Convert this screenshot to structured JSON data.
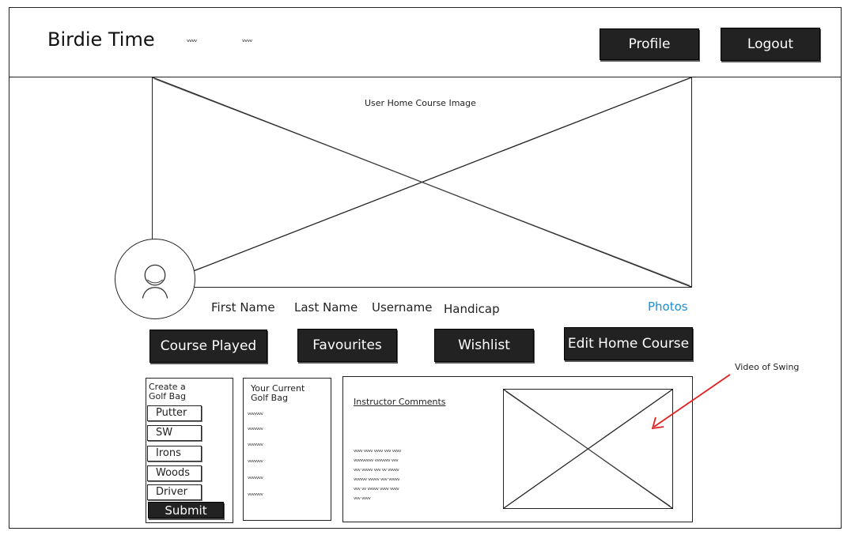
{
  "header": {
    "brand": "Birdie Time",
    "nav_squiggles": [
      "ᵥᵥᵥᵥ",
      "ᵥᵥᵥᵥ"
    ],
    "profile_label": "Profile",
    "logout_label": "Logout"
  },
  "hero": {
    "caption": "User Home Course Image"
  },
  "profile": {
    "first_name": "First Name",
    "last_name": "Last Name",
    "username": "Username",
    "handicap": "Handicap",
    "photos_link": "Photos"
  },
  "tabs": [
    {
      "label": "Course Played"
    },
    {
      "label": "Favourites"
    },
    {
      "label": "Wishlist"
    },
    {
      "label": "Edit Home Course"
    }
  ],
  "golf_bag_builder": {
    "title_line1": "Create a",
    "title_line2": "Golf Bag",
    "clubs": [
      "Putter",
      "SW",
      "Irons",
      "Woods",
      "Driver"
    ],
    "submit_label": "Submit"
  },
  "current_bag": {
    "title_line1": "Your Current",
    "title_line2": "Golf Bag",
    "items": [
      "ᵥᵥᵥᵥᵥᵥᵥ",
      "ᵥᵥᵥᵥᵥᵥᵥ",
      "ᵥᵥᵥᵥᵥᵥᵥ",
      "ᵥᵥᵥᵥᵥᵥᵥ",
      "ᵥᵥᵥᵥᵥᵥᵥ",
      "ᵥᵥᵥᵥᵥᵥᵥ"
    ]
  },
  "instructor": {
    "heading": "Instructor Comments",
    "comment_lines": [
      "ᵥᵥᵥᵥ ᵥᵥᵥᵥ ᵥᵥᵥᵥ ᵥᵥᵥ ᵥᵥᵥᵥ",
      "ᵥᵥᵥᵥᵥᵥᵥᵥᵥ ᵥᵥᵥᵥᵥᵥᵥ ᵥᵥᵥ",
      "ᵥᵥᵥ ᵥᵥᵥᵥᵥ ᵥᵥᵥ ᵥᵥ ᵥᵥᵥᵥᵥ",
      "ᵥᵥᵥᵥᵥᵥ ᵥᵥᵥᵥᵥ ᵥᵥᵥ ᵥᵥᵥᵥᵥ",
      "ᵥᵥᵥ ᵥᵥ ᵥᵥᵥᵥᵥ ᵥᵥᵥᵥ ᵥᵥᵥᵥ",
      "ᵥᵥᵥ ᵥᵥᵥᵥ"
    ],
    "video_annotation": "Video of Swing"
  },
  "colors": {
    "button_dark": "#222222",
    "link_blue": "#1a8fd6",
    "annotation_arrow": "#e02020"
  }
}
